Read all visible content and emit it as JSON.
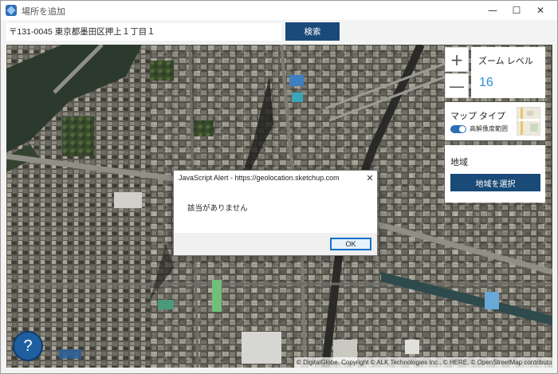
{
  "window": {
    "title": "場所を追加",
    "minimize_glyph": "—",
    "maximize_glyph": "☐",
    "close_glyph": "✕"
  },
  "search": {
    "value": "〒131-0045 東京都墨田区押上１丁目１",
    "button_label": "検索"
  },
  "map_controls": {
    "zoom_in_glyph": "+",
    "zoom_out_glyph": "—",
    "zoom_label": "ズーム レベル",
    "zoom_level": "16",
    "map_type_label": "マップ タイプ",
    "hi_res_toggle_label": "高解像度範囲",
    "hi_res_toggle_on": true,
    "region_label": "地域",
    "region_button_label": "地域を選択"
  },
  "help": {
    "glyph": "?"
  },
  "attribution": "© DigitalGlobe, Copyright © ALK Technologies Inc., © HERE, © OpenStreetMap contributors",
  "dialog": {
    "title": "JavaScript Alert - https://geolocation.sketchup.com",
    "close_glyph": "✕",
    "message": "該当がありません",
    "ok_label": "OK"
  },
  "colors": {
    "accent": "#1a4a78",
    "zoom_value": "#2c8fd6",
    "help_button": "#1f5fa0",
    "ok_border": "#1a6fc9"
  },
  "icons": [
    "app-icon",
    "help-icon",
    "close-icon",
    "minimize-icon",
    "maximize-icon",
    "map-thumbnail-icon"
  ]
}
